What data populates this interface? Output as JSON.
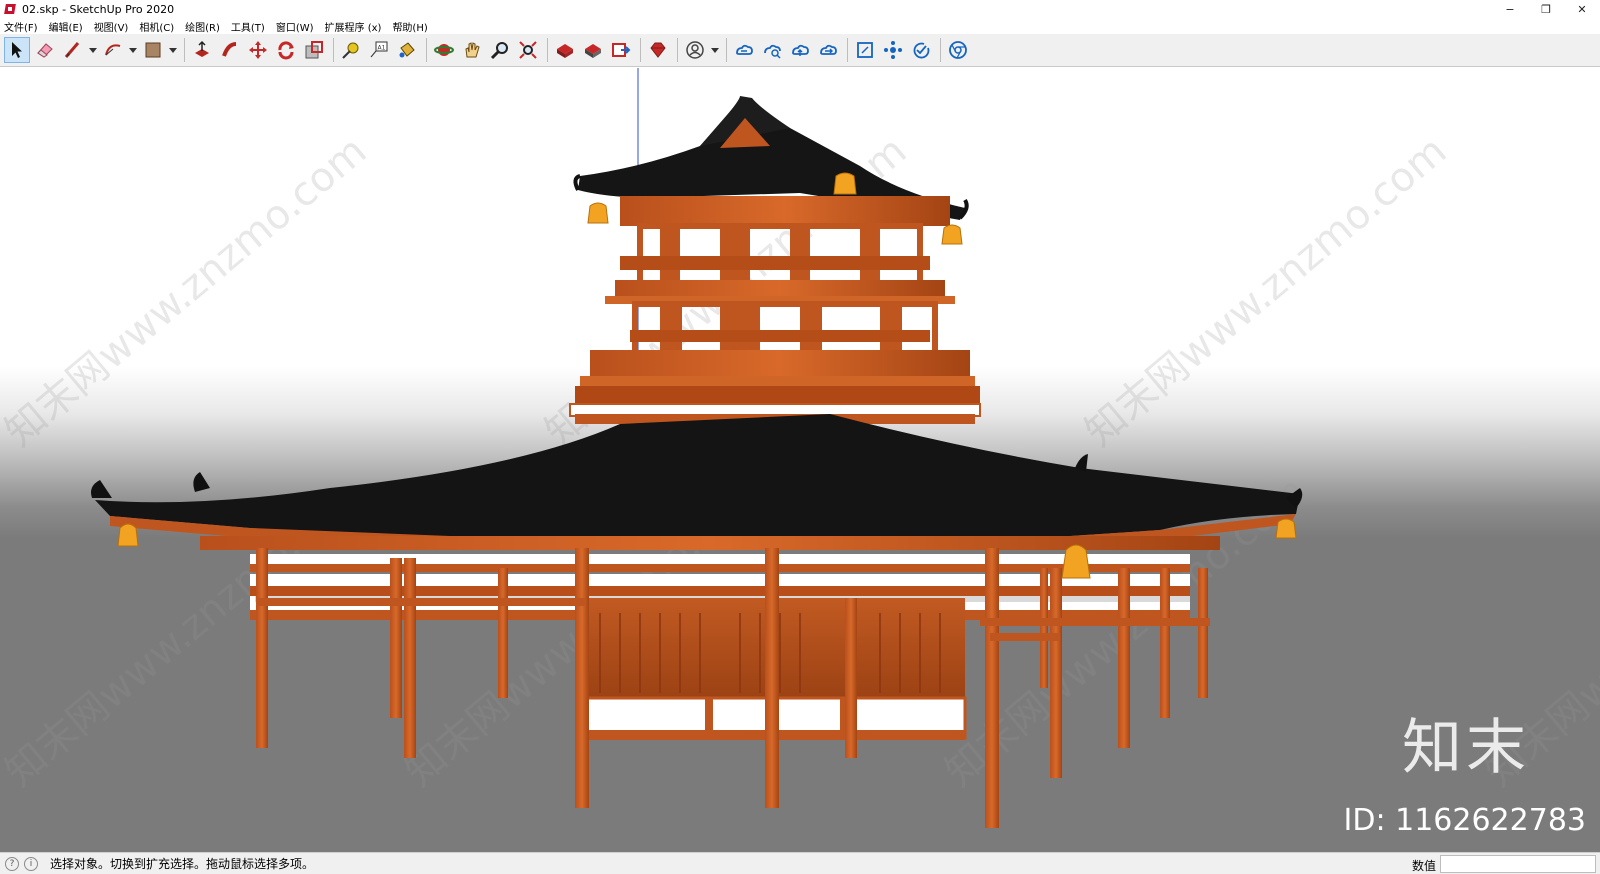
{
  "window": {
    "title": "02.skp - SketchUp Pro 2020",
    "controls": [
      "minimize",
      "restore",
      "close"
    ],
    "control_glyphs": [
      "−",
      "❐",
      "✕"
    ]
  },
  "menu": [
    "文件(F)",
    "编辑(E)",
    "视图(V)",
    "相机(C)",
    "绘图(R)",
    "工具(T)",
    "窗口(W)",
    "扩展程序 (x)",
    "帮助(H)"
  ],
  "toolbar": {
    "tools": [
      {
        "name": "select-tool-icon",
        "active": true
      },
      {
        "name": "eraser-tool-icon"
      },
      {
        "name": "line-tool-icon",
        "dropdown": true
      },
      {
        "name": "arc-tool-icon",
        "dropdown": true
      },
      {
        "name": "rectangle-tool-icon",
        "dropdown": true
      },
      {
        "name": "push-pull-tool-icon"
      },
      {
        "name": "follow-me-tool-icon"
      },
      {
        "name": "move-tool-icon"
      },
      {
        "name": "rotate-tool-icon"
      },
      {
        "name": "scale-tool-icon"
      },
      {
        "name": "tape-measure-tool-icon"
      },
      {
        "name": "text-tool-icon"
      },
      {
        "name": "paint-bucket-tool-icon"
      },
      {
        "name": "orbit-tool-icon"
      },
      {
        "name": "pan-tool-icon"
      },
      {
        "name": "zoom-tool-icon"
      },
      {
        "name": "zoom-extents-tool-icon"
      },
      {
        "name": "3d-warehouse-icon"
      },
      {
        "name": "extension-warehouse-icon"
      },
      {
        "name": "layout-send-icon"
      },
      {
        "name": "extension-manager-icon"
      },
      {
        "name": "account-icon",
        "dropdown": true
      },
      {
        "name": "trimble-connect-icon"
      },
      {
        "name": "cloud-search-icon"
      },
      {
        "name": "cloud-upload-icon"
      },
      {
        "name": "cloud-sync-icon"
      },
      {
        "name": "scan-essentials-icon"
      },
      {
        "name": "classifier-icon"
      },
      {
        "name": "check-icon"
      },
      {
        "name": "chrome-icon"
      }
    ]
  },
  "watermark": {
    "logo": "知末",
    "id_text": "ID: 1162622783",
    "diagonal_text": "知末网www.znzmo.com"
  },
  "status": {
    "text": "选择对象。切换到扩充选择。拖动鼠标选择多项。",
    "measurements_label": "数值",
    "measurements_value": ""
  },
  "colors": {
    "roof": "#141414",
    "timber": "#c0561f",
    "timber_dark": "#8a3410",
    "bell": "#f2a321",
    "ground": "#7b7b7b",
    "sky": "#ffffff"
  }
}
